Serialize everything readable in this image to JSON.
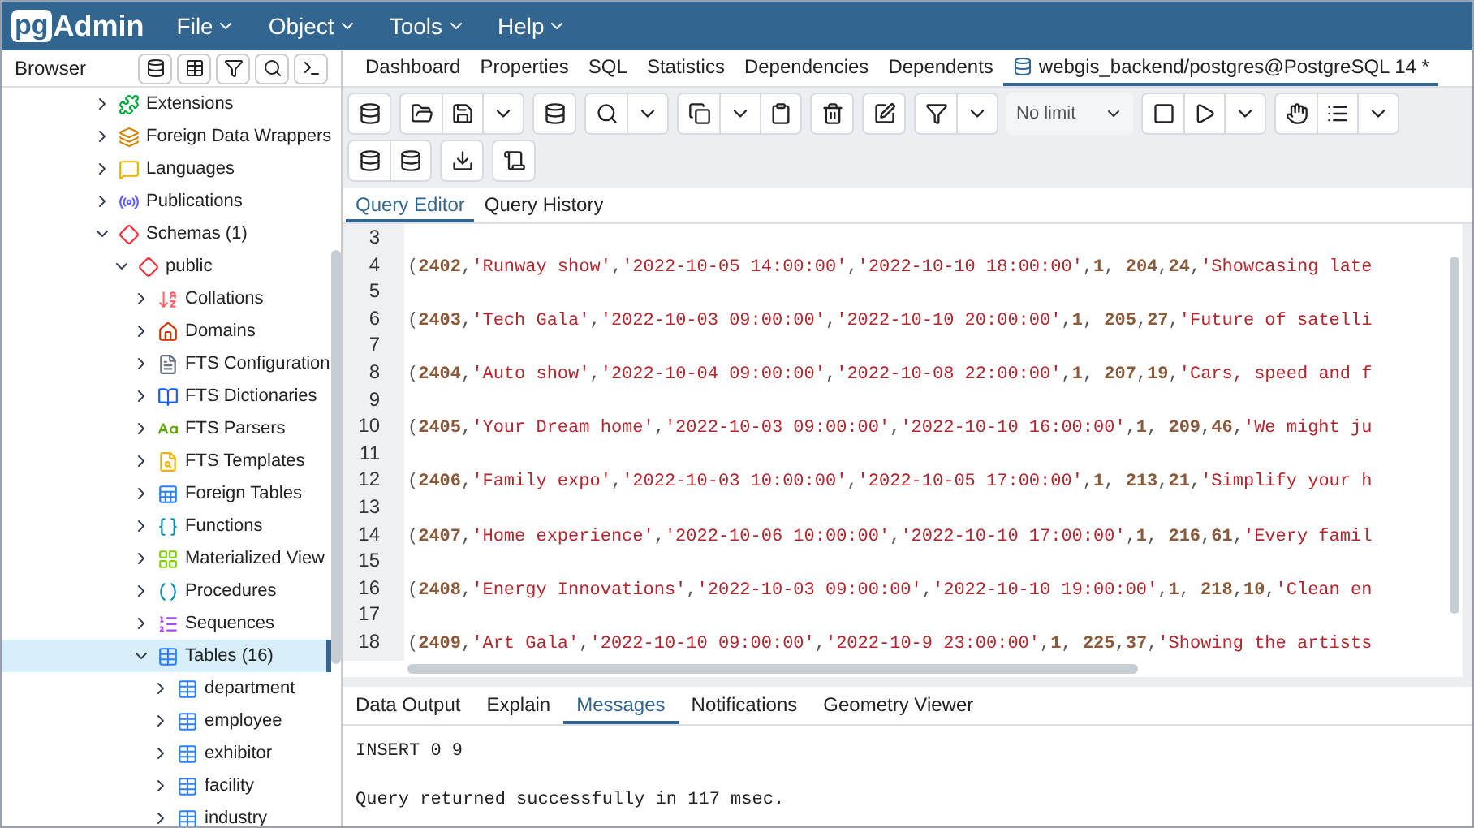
{
  "app": {
    "logo_box": "pg",
    "logo_text": "Admin",
    "menu": [
      "File",
      "Object",
      "Tools",
      "Help"
    ]
  },
  "browser": {
    "title": "Browser",
    "tree": [
      {
        "label": "Extensions",
        "kind": "extension",
        "expanded": false,
        "selected": false
      },
      {
        "label": "Foreign Data Wrappers",
        "kind": "fdw",
        "expanded": false,
        "selected": false
      },
      {
        "label": "Languages",
        "kind": "language",
        "expanded": false,
        "selected": false
      },
      {
        "label": "Publications",
        "kind": "publication",
        "expanded": false,
        "selected": false
      },
      {
        "label": "Schemas (1)",
        "kind": "schemas",
        "expanded": true,
        "selected": false,
        "children": [
          {
            "label": "public",
            "kind": "schema",
            "expanded": true,
            "selected": false,
            "children": [
              {
                "label": "Collations",
                "kind": "collation",
                "expanded": false,
                "selected": false
              },
              {
                "label": "Domains",
                "kind": "domain",
                "expanded": false,
                "selected": false
              },
              {
                "label": "FTS Configuration",
                "kind": "ftsconfig",
                "expanded": false,
                "selected": false
              },
              {
                "label": "FTS Dictionaries",
                "kind": "ftsdict",
                "expanded": false,
                "selected": false
              },
              {
                "label": "FTS Parsers",
                "kind": "ftsparser",
                "expanded": false,
                "selected": false
              },
              {
                "label": "FTS Templates",
                "kind": "ftstemplate",
                "expanded": false,
                "selected": false
              },
              {
                "label": "Foreign Tables",
                "kind": "foreigntable",
                "expanded": false,
                "selected": false
              },
              {
                "label": "Functions",
                "kind": "function",
                "expanded": false,
                "selected": false
              },
              {
                "label": "Materialized View",
                "kind": "mview",
                "expanded": false,
                "selected": false
              },
              {
                "label": "Procedures",
                "kind": "procedure",
                "expanded": false,
                "selected": false
              },
              {
                "label": "Sequences",
                "kind": "sequence",
                "expanded": false,
                "selected": false
              },
              {
                "label": "Tables (16)",
                "kind": "tables",
                "expanded": true,
                "selected": true,
                "children": [
                  {
                    "label": "department",
                    "kind": "table",
                    "expanded": false,
                    "selected": false
                  },
                  {
                    "label": "employee",
                    "kind": "table",
                    "expanded": false,
                    "selected": false
                  },
                  {
                    "label": "exhibitor",
                    "kind": "table",
                    "expanded": false,
                    "selected": false
                  },
                  {
                    "label": "facility",
                    "kind": "table",
                    "expanded": false,
                    "selected": false
                  },
                  {
                    "label": "industry",
                    "kind": "table",
                    "expanded": false,
                    "selected": false
                  }
                ]
              }
            ]
          }
        ]
      }
    ]
  },
  "tabs": [
    {
      "label": "Dashboard",
      "selected": false
    },
    {
      "label": "Properties",
      "selected": false
    },
    {
      "label": "SQL",
      "selected": false
    },
    {
      "label": "Statistics",
      "selected": false
    },
    {
      "label": "Dependencies",
      "selected": false
    },
    {
      "label": "Dependents",
      "selected": false
    },
    {
      "label": "webgis_backend/postgres@PostgreSQL 14 *",
      "selected": true
    }
  ],
  "toolbar": {
    "row_limit": "No limit"
  },
  "editor_tabs": [
    {
      "label": "Query Editor",
      "selected": true
    },
    {
      "label": "Query History",
      "selected": false
    }
  ],
  "editor_lines": [
    {
      "number": "3"
    },
    {
      "number": "4",
      "text": "(2402,'Runway show','2022-10-05 14:00:00','2022-10-10 18:00:00',1, 204,24,'Showcasing late"
    },
    {
      "number": "5"
    },
    {
      "number": "6",
      "text": "(2403,'Tech Gala','2022-10-03 09:00:00','2022-10-10 20:00:00',1, 205,27,'Future of satelli"
    },
    {
      "number": "7"
    },
    {
      "number": "8",
      "text": "(2404,'Auto show','2022-10-04 09:00:00','2022-10-08 22:00:00',1, 207,19,'Cars, speed and f"
    },
    {
      "number": "9"
    },
    {
      "number": "10",
      "text": "(2405,'Your Dream home','2022-10-03 09:00:00','2022-10-10 16:00:00',1, 209,46,'We might ju"
    },
    {
      "number": "11"
    },
    {
      "number": "12",
      "text": "(2406,'Family expo','2022-10-03 10:00:00','2022-10-05 17:00:00',1, 213,21,'Simplify your h"
    },
    {
      "number": "13"
    },
    {
      "number": "14",
      "text": "(2407,'Home experience','2022-10-06 10:00:00','2022-10-10 17:00:00',1, 216,61,'Every famil"
    },
    {
      "number": "15"
    },
    {
      "number": "16",
      "text": "(2408,'Energy Innovations','2022-10-03 09:00:00','2022-10-10 19:00:00',1, 218,10,'Clean en"
    },
    {
      "number": "17"
    },
    {
      "number": "18",
      "text": "(2409,'Art Gala','2022-10-10 09:00:00','2022-10-9 23:00:00',1, 225,37,'Showing the artists"
    }
  ],
  "output_tabs": [
    {
      "label": "Data Output",
      "selected": false
    },
    {
      "label": "Explain",
      "selected": false
    },
    {
      "label": "Messages",
      "selected": true
    },
    {
      "label": "Notifications",
      "selected": false
    },
    {
      "label": "Geometry Viewer",
      "selected": false
    }
  ],
  "messages": [
    "INSERT 0 9",
    "Query returned successfully in 117 msec."
  ]
}
